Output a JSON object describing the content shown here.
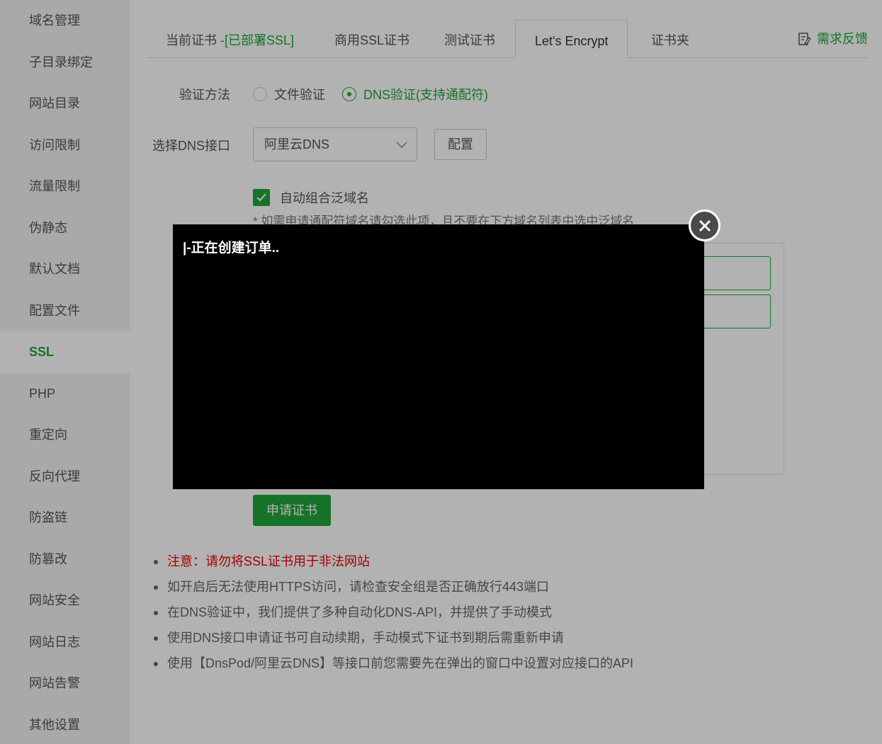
{
  "sidebar": {
    "items": [
      {
        "label": "域名管理"
      },
      {
        "label": "子目录绑定"
      },
      {
        "label": "网站目录"
      },
      {
        "label": "访问限制"
      },
      {
        "label": "流量限制"
      },
      {
        "label": "伪静态"
      },
      {
        "label": "默认文档"
      },
      {
        "label": "配置文件"
      },
      {
        "label": "SSL",
        "active": true
      },
      {
        "label": "PHP"
      },
      {
        "label": "重定向"
      },
      {
        "label": "反向代理"
      },
      {
        "label": "防盗链"
      },
      {
        "label": "防篡改"
      },
      {
        "label": "网站安全"
      },
      {
        "label": "网站日志"
      },
      {
        "label": "网站告警"
      },
      {
        "label": "其他设置"
      }
    ]
  },
  "tabs": {
    "current_cert_prefix": "当前证书",
    "current_cert_status": " -[已部署SSL]",
    "commercial": "商用SSL证书",
    "test": "测试证书",
    "letsencrypt": "Let's Encrypt",
    "folder": "证书夹",
    "feedback": "需求反馈",
    "active": "Let's Encrypt"
  },
  "form": {
    "verify_method_label": "验证方法",
    "verify_file": "文件验证",
    "verify_dns": "DNS验证(支持通配符)",
    "verify_selected": "dns",
    "dns_select_label": "选择DNS接口",
    "dns_select_value": "阿里云DNS",
    "config_button": "配置",
    "auto_wildcard_label": "自动组合泛域名",
    "auto_wildcard_checked": true,
    "hint": "* 如需申请通配符域名请勾选此项，且不要在下方域名列表中选中泛域名",
    "apply_button": "申请证书"
  },
  "notes": [
    {
      "text": "注意：请勿将SSL证书用于非法网站",
      "warn": true
    },
    {
      "text": "如开启后无法使用HTTPS访问，请检查安全组是否正确放行443端口"
    },
    {
      "text": "在DNS验证中，我们提供了多种自动化DNS-API，并提供了手动模式"
    },
    {
      "text": "使用DNS接口申请证书可自动续期，手动模式下证书到期后需重新申请"
    },
    {
      "text": "使用【DnsPod/阿里云DNS】等接口前您需要先在弹出的窗口中设置对应接口的API"
    }
  ],
  "modal": {
    "log_text": "|-正在创建订单.."
  },
  "colors": {
    "accent": "#20a53a",
    "warn": "#e00000",
    "overlay": "rgba(0,0,0,0.3)"
  }
}
